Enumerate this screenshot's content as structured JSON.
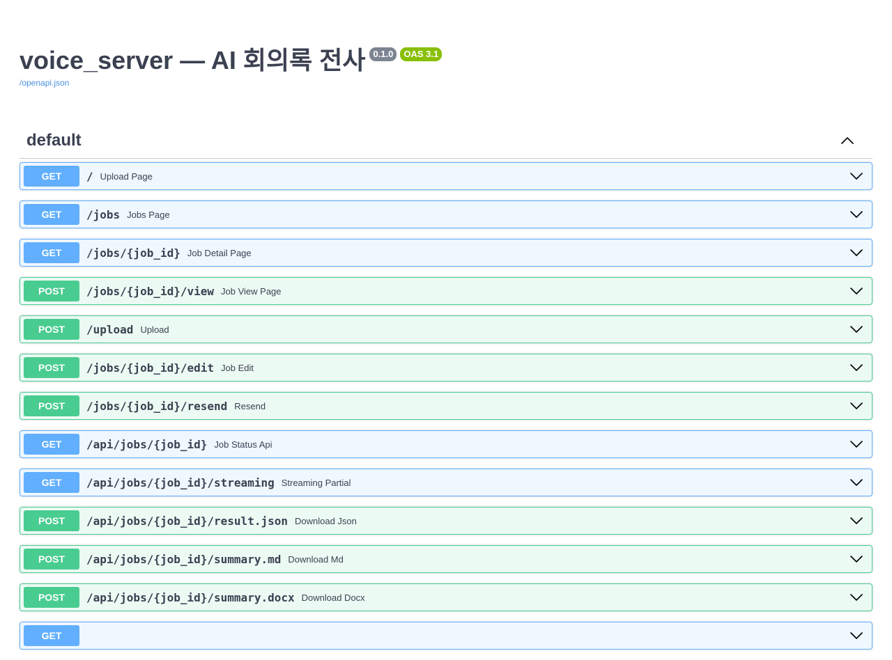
{
  "info": {
    "title": "voice_server — AI 회의록 전사",
    "version": "0.1.0",
    "oas": "OAS 3.1",
    "spec_link": "/openapi.json"
  },
  "tag": {
    "name": "default"
  },
  "colors": {
    "get": "#61affe",
    "post": "#49cc90",
    "text": "#3b4151",
    "link": "#4990e2"
  },
  "operations": [
    {
      "method": "GET",
      "path": "/",
      "summary": "Upload Page"
    },
    {
      "method": "GET",
      "path": "/jobs",
      "summary": "Jobs Page"
    },
    {
      "method": "GET",
      "path": "/jobs/{job_id}",
      "summary": "Job Detail Page"
    },
    {
      "method": "POST",
      "path": "/jobs/{job_id}/view",
      "summary": "Job View Page"
    },
    {
      "method": "POST",
      "path": "/upload",
      "summary": "Upload"
    },
    {
      "method": "POST",
      "path": "/jobs/{job_id}/edit",
      "summary": "Job Edit"
    },
    {
      "method": "POST",
      "path": "/jobs/{job_id}/resend",
      "summary": "Resend"
    },
    {
      "method": "GET",
      "path": "/api/jobs/{job_id}",
      "summary": "Job Status Api"
    },
    {
      "method": "GET",
      "path": "/api/jobs/{job_id}/streaming",
      "summary": "Streaming Partial"
    },
    {
      "method": "POST",
      "path": "/api/jobs/{job_id}/result.json",
      "summary": "Download Json"
    },
    {
      "method": "POST",
      "path": "/api/jobs/{job_id}/summary.md",
      "summary": "Download Md"
    },
    {
      "method": "POST",
      "path": "/api/jobs/{job_id}/summary.docx",
      "summary": "Download Docx"
    },
    {
      "method": "GET",
      "path": "",
      "summary": ""
    }
  ]
}
